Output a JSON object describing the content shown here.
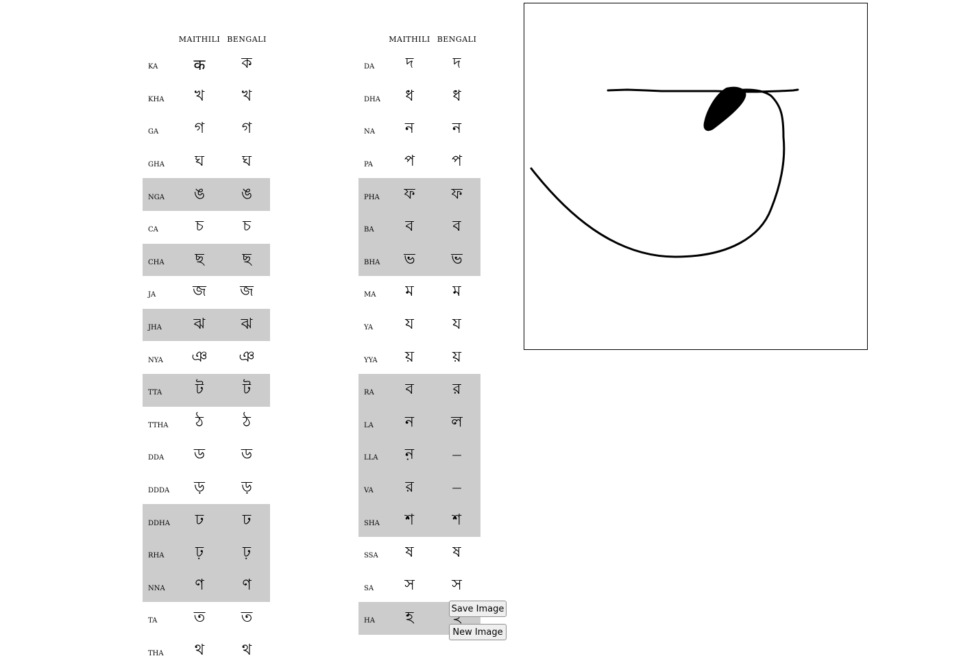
{
  "tables": [
    {
      "headers": [
        "",
        "MAITHILI",
        "BENGALI"
      ],
      "rows": [
        {
          "roman": "KA",
          "maithili": "क",
          "bengali": "ক",
          "highlight": false
        },
        {
          "roman": "KHA",
          "maithili": "খ",
          "bengali": "খ",
          "highlight": false
        },
        {
          "roman": "GA",
          "maithili": "গ",
          "bengali": "গ",
          "highlight": false
        },
        {
          "roman": "GHA",
          "maithili": "ঘ",
          "bengali": "ঘ",
          "highlight": false
        },
        {
          "roman": "NGA",
          "maithili": "ঙ",
          "bengali": "ঙ",
          "highlight": true
        },
        {
          "roman": "CA",
          "maithili": "চ",
          "bengali": "চ",
          "highlight": false
        },
        {
          "roman": "CHA",
          "maithili": "ছ",
          "bengali": "ছ",
          "highlight": true
        },
        {
          "roman": "JA",
          "maithili": "জ",
          "bengali": "জ",
          "highlight": false
        },
        {
          "roman": "JHA",
          "maithili": "ঝ",
          "bengali": "ঝ",
          "highlight": true
        },
        {
          "roman": "NYA",
          "maithili": "ঞ",
          "bengali": "ঞ",
          "highlight": false
        },
        {
          "roman": "TTA",
          "maithili": "ট",
          "bengali": "ট",
          "highlight": true
        },
        {
          "roman": "TTHA",
          "maithili": "ঠ",
          "bengali": "ঠ",
          "highlight": false
        },
        {
          "roman": "DDA",
          "maithili": "ড",
          "bengali": "ড",
          "highlight": false
        },
        {
          "roman": "DDDA",
          "maithili": "ড়",
          "bengali": "ড়",
          "highlight": false
        },
        {
          "roman": "DDHA",
          "maithili": "ঢ",
          "bengali": "ঢ",
          "highlight": true
        },
        {
          "roman": "RHA",
          "maithili": "ঢ়",
          "bengali": "ঢ়",
          "highlight": true
        },
        {
          "roman": "NNA",
          "maithili": "ণ",
          "bengali": "ণ",
          "highlight": true
        },
        {
          "roman": "TA",
          "maithili": "ত",
          "bengali": "ত",
          "highlight": false
        },
        {
          "roman": "THA",
          "maithili": "থ",
          "bengali": "থ",
          "highlight": false
        }
      ]
    },
    {
      "headers": [
        "",
        "MAITHILI",
        "BENGALI"
      ],
      "rows": [
        {
          "roman": "DA",
          "maithili": "দ",
          "bengali": "দ",
          "highlight": false
        },
        {
          "roman": "DHA",
          "maithili": "ধ",
          "bengali": "ধ",
          "highlight": false
        },
        {
          "roman": "NA",
          "maithili": "ন",
          "bengali": "ন",
          "highlight": false
        },
        {
          "roman": "PA",
          "maithili": "প",
          "bengali": "প",
          "highlight": false
        },
        {
          "roman": "PHA",
          "maithili": "ফ",
          "bengali": "ফ",
          "highlight": true
        },
        {
          "roman": "BA",
          "maithili": "ব",
          "bengali": "ব",
          "highlight": true
        },
        {
          "roman": "BHA",
          "maithili": "ভ",
          "bengali": "ভ",
          "highlight": true
        },
        {
          "roman": "MA",
          "maithili": "ম",
          "bengali": "ম",
          "highlight": false
        },
        {
          "roman": "YA",
          "maithili": "য",
          "bengali": "য",
          "highlight": false
        },
        {
          "roman": "YYA",
          "maithili": "য়",
          "bengali": "য়",
          "highlight": false
        },
        {
          "roman": "RA",
          "maithili": "ব",
          "bengali": "র",
          "highlight": true
        },
        {
          "roman": "LA",
          "maithili": "ন",
          "bengali": "ল",
          "highlight": true
        },
        {
          "roman": "LLA",
          "maithili": "ন়",
          "bengali": "—",
          "highlight": true
        },
        {
          "roman": "VA",
          "maithili": "র",
          "bengali": "—",
          "highlight": true
        },
        {
          "roman": "SHA",
          "maithili": "শ",
          "bengali": "শ",
          "highlight": true
        },
        {
          "roman": "SSA",
          "maithili": "ষ",
          "bengali": "ষ",
          "highlight": false
        },
        {
          "roman": "SA",
          "maithili": "স",
          "bengali": "স",
          "highlight": false
        },
        {
          "roman": "HA",
          "maithili": "হ",
          "bengali": "হ",
          "highlight": true
        }
      ]
    }
  ],
  "buttons": {
    "save_label": "Save Image",
    "new_label": "New Image"
  },
  "colors": {
    "highlight_row": "#cccccc",
    "stroke": "#000000",
    "canvas_border": "#000000"
  }
}
